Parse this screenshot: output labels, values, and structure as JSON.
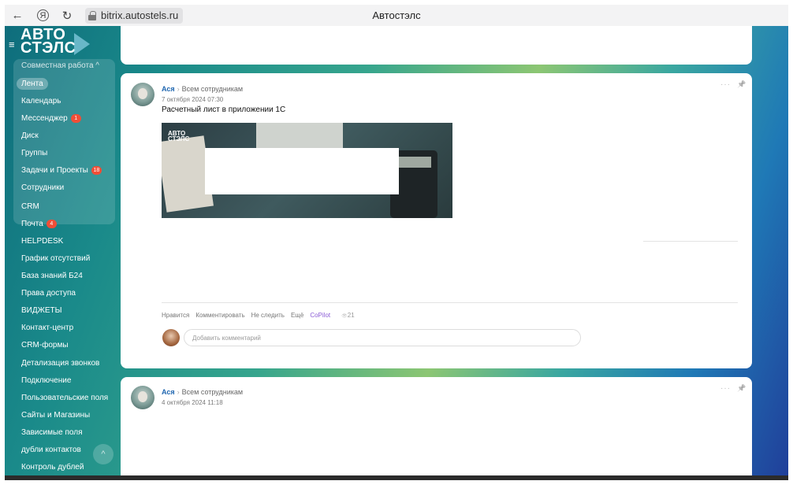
{
  "browser": {
    "back_icon": "←",
    "yandex_icon": "Я",
    "reload_icon": "↻",
    "url": "bitrix.autostels.ru",
    "page_title": "Автостэлс"
  },
  "sidebar": {
    "logo_line1": "АВТО",
    "logo_line2": "СТЭЛС",
    "group_title": "Совместная работа ^",
    "group_items": [
      {
        "label": "Лента",
        "badge": ""
      },
      {
        "label": "Календарь",
        "badge": ""
      },
      {
        "label": "Мессенджер",
        "badge": "1"
      },
      {
        "label": "Диск",
        "badge": ""
      },
      {
        "label": "Группы",
        "badge": ""
      },
      {
        "label": "Задачи и Проекты",
        "badge": "18"
      },
      {
        "label": "Сотрудники",
        "badge": ""
      }
    ],
    "items": [
      {
        "label": "CRM",
        "badge": ""
      },
      {
        "label": "Почта",
        "badge": "4"
      },
      {
        "label": "HELPDESK",
        "badge": ""
      },
      {
        "label": "График отсутствий",
        "badge": ""
      },
      {
        "label": "База знаний Б24",
        "badge": ""
      },
      {
        "label": "Права доступа",
        "badge": ""
      },
      {
        "label": "ВИДЖЕТЫ",
        "badge": ""
      },
      {
        "label": "Контакт-центр",
        "badge": ""
      },
      {
        "label": "CRM-формы",
        "badge": ""
      },
      {
        "label": "Детализация звонков",
        "badge": ""
      },
      {
        "label": "Подключение",
        "badge": ""
      },
      {
        "label": "Пользовательские поля",
        "badge": ""
      },
      {
        "label": "Сайты и Магазины",
        "badge": ""
      },
      {
        "label": "Зависимые поля",
        "badge": ""
      },
      {
        "label": "дубли контактов",
        "badge": ""
      },
      {
        "label": "Контроль дублей",
        "badge": ""
      }
    ]
  },
  "posts": [
    {
      "author": "Ася",
      "target": "Всем сотрудникам",
      "date": "7 октября 2024 07:30",
      "text": "Расчетный лист в приложении 1С",
      "image_logo_line1": "АВТО",
      "image_logo_line2": "СТЭЛС",
      "actions": {
        "like": "Нравится",
        "comment": "Комментировать",
        "unfollow": "Не следить",
        "more": "Ещё",
        "copilot": "CoPilot",
        "views": "21"
      },
      "comment_placeholder": "Добавить комментарий"
    },
    {
      "author": "Ася",
      "target": "Всем сотрудникам",
      "date": "4 октября 2024 11:18"
    }
  ],
  "icons": {
    "more": "···",
    "pin": "📌",
    "hamburger": "≡",
    "scroll_up": "^",
    "eye": "👁"
  }
}
